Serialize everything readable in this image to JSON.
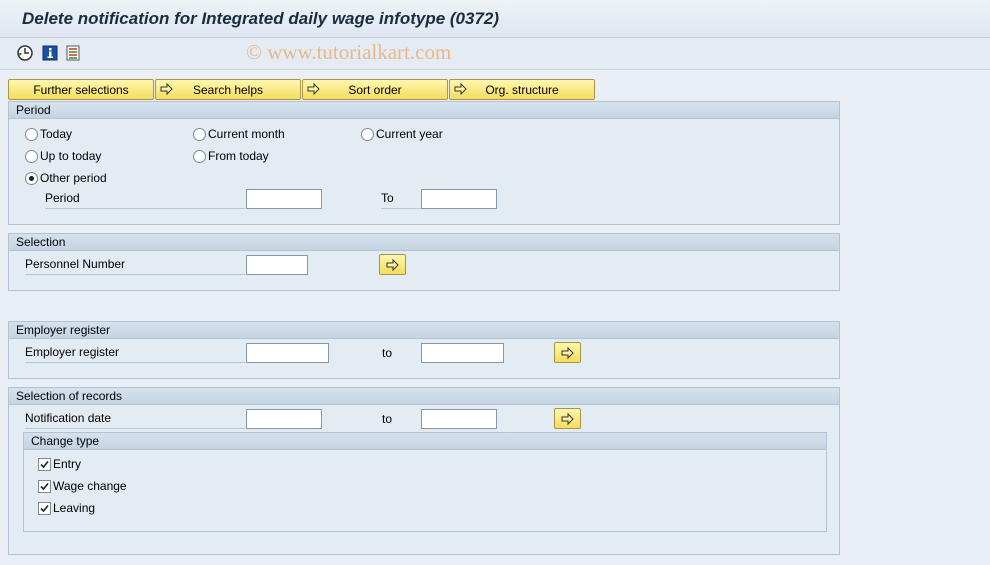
{
  "window": {
    "title": "Delete notification for Integrated daily wage infotype (0372)"
  },
  "toolbar": {
    "icons": [
      "execute-clock-icon",
      "info-icon",
      "selection-options-icon"
    ],
    "watermark": "© www.tutorialkart.com"
  },
  "tabs": {
    "further_selections": "Further selections",
    "search_helps": "Search helps",
    "sort_order": "Sort order",
    "org_structure": "Org. structure"
  },
  "period": {
    "header": "Period",
    "today": "Today",
    "current_month": "Current month",
    "current_year": "Current year",
    "up_to_today": "Up to today",
    "from_today": "From today",
    "other_period": "Other period",
    "selected": "other_period",
    "period_label": "Period",
    "to_label": "To",
    "from_value": "",
    "to_value": ""
  },
  "selection": {
    "header": "Selection",
    "personnel_label": "Personnel Number",
    "personnel_value": ""
  },
  "employer": {
    "header": "Employer register",
    "label": "Employer register",
    "to_label": "to",
    "from_value": "",
    "to_value": ""
  },
  "records": {
    "header": "Selection of records",
    "notification_label": "Notification date",
    "to_label": "to",
    "from_value": "",
    "to_value": "",
    "change_type": {
      "header": "Change type",
      "entry": "Entry",
      "wage_change": "Wage change",
      "leaving": "Leaving",
      "entry_checked": true,
      "wage_change_checked": true,
      "leaving_checked": true
    }
  },
  "colors": {
    "background": "#e9eff5",
    "button_yellow": "#f3dd5d",
    "group_header": "#c5d4e3"
  }
}
